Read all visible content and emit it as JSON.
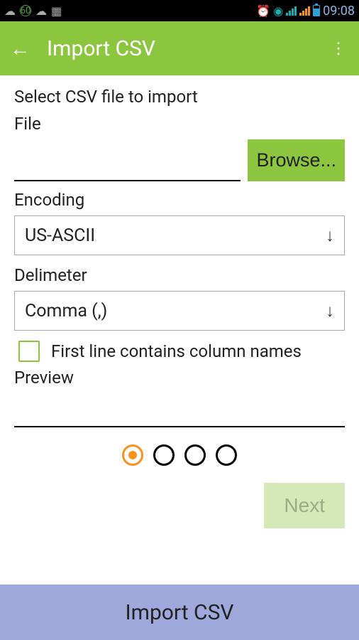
{
  "status": {
    "time": "09:08"
  },
  "appbar": {
    "title": "Import CSV"
  },
  "content": {
    "instruction": "Select CSV file to import",
    "file_label": "File",
    "browse_label": "Browse...",
    "encoding_label": "Encoding",
    "encoding_value": "US-ASCII",
    "delimiter_label": "Delimeter",
    "delimiter_value": "Comma (,)",
    "firstline_label": "First line contains column names",
    "preview_label": "Preview",
    "next_label": "Next"
  },
  "banner": {
    "label": "Import CSV"
  }
}
